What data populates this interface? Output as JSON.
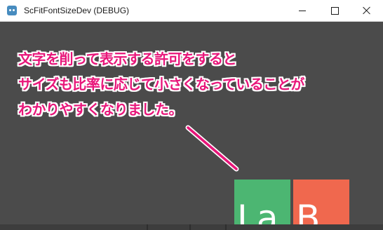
{
  "window": {
    "title": "ScFitFontSizeDev (DEBUG)",
    "icon": "godot-engine-icon",
    "controls": [
      "minimize",
      "maximize",
      "close"
    ]
  },
  "annotation": {
    "lines": [
      "文字を削って表示する許可をすると",
      "サイズも比率に応じて小さくなっていることが",
      "わかりやすくなりました。"
    ],
    "color": "#e8167a",
    "outline_color": "#ffffff"
  },
  "tiles": [
    {
      "label": "La",
      "color": "#4cb672"
    },
    {
      "label": "B",
      "color": "#f0684e"
    }
  ],
  "colors": {
    "viewport_background": "#4b4b4b",
    "arrow": "#e8167a"
  }
}
